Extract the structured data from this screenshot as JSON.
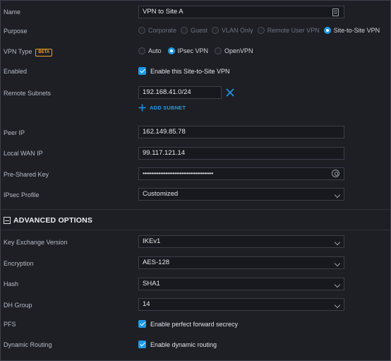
{
  "form": {
    "name": {
      "label": "Name",
      "value": "VPN to Site A"
    },
    "purpose": {
      "label": "Purpose",
      "options": [
        "Corporate",
        "Guest",
        "VLAN Only",
        "Remote User VPN",
        "Site-to-Site VPN"
      ],
      "selected": "Site-to-Site VPN"
    },
    "vpn_type": {
      "label": "VPN Type",
      "badge": "BETA",
      "options": [
        "Auto",
        "IPsec VPN",
        "OpenVPN"
      ],
      "selected": "IPsec VPN"
    },
    "enabled": {
      "label": "Enabled",
      "checkbox_label": "Enable this Site-to-Site VPN",
      "checked": true
    },
    "remote_subnets": {
      "label": "Remote Subnets",
      "value": "192.168.41.0/24",
      "add_label": "ADD SUBNET"
    },
    "peer_ip": {
      "label": "Peer IP",
      "value": "162.149.85.78"
    },
    "local_wan_ip": {
      "label": "Local WAN IP",
      "value": "99.117.121.14"
    },
    "pre_shared_key": {
      "label": "Pre-Shared Key",
      "value": "••••••••••••••••••••••••••••••••••••••••"
    },
    "ipsec_profile": {
      "label": "IPsec Profile",
      "value": "Customized"
    }
  },
  "advanced": {
    "title": "ADVANCED OPTIONS",
    "key_exchange": {
      "label": "Key Exchange Version",
      "value": "IKEv1"
    },
    "encryption": {
      "label": "Encryption",
      "value": "AES-128"
    },
    "hash": {
      "label": "Hash",
      "value": "SHA1"
    },
    "dh_group": {
      "label": "DH Group",
      "value": "14"
    },
    "pfs": {
      "label": "PFS",
      "checkbox_label": "Enable perfect forward secrecy",
      "checked": true
    },
    "dynamic_routing": {
      "label": "Dynamic Routing",
      "checkbox_label": "Enable dynamic routing",
      "checked": true
    }
  },
  "colors": {
    "accent": "#1c9ae8",
    "background": "#1d1f25",
    "badge": "#f0a02a"
  }
}
